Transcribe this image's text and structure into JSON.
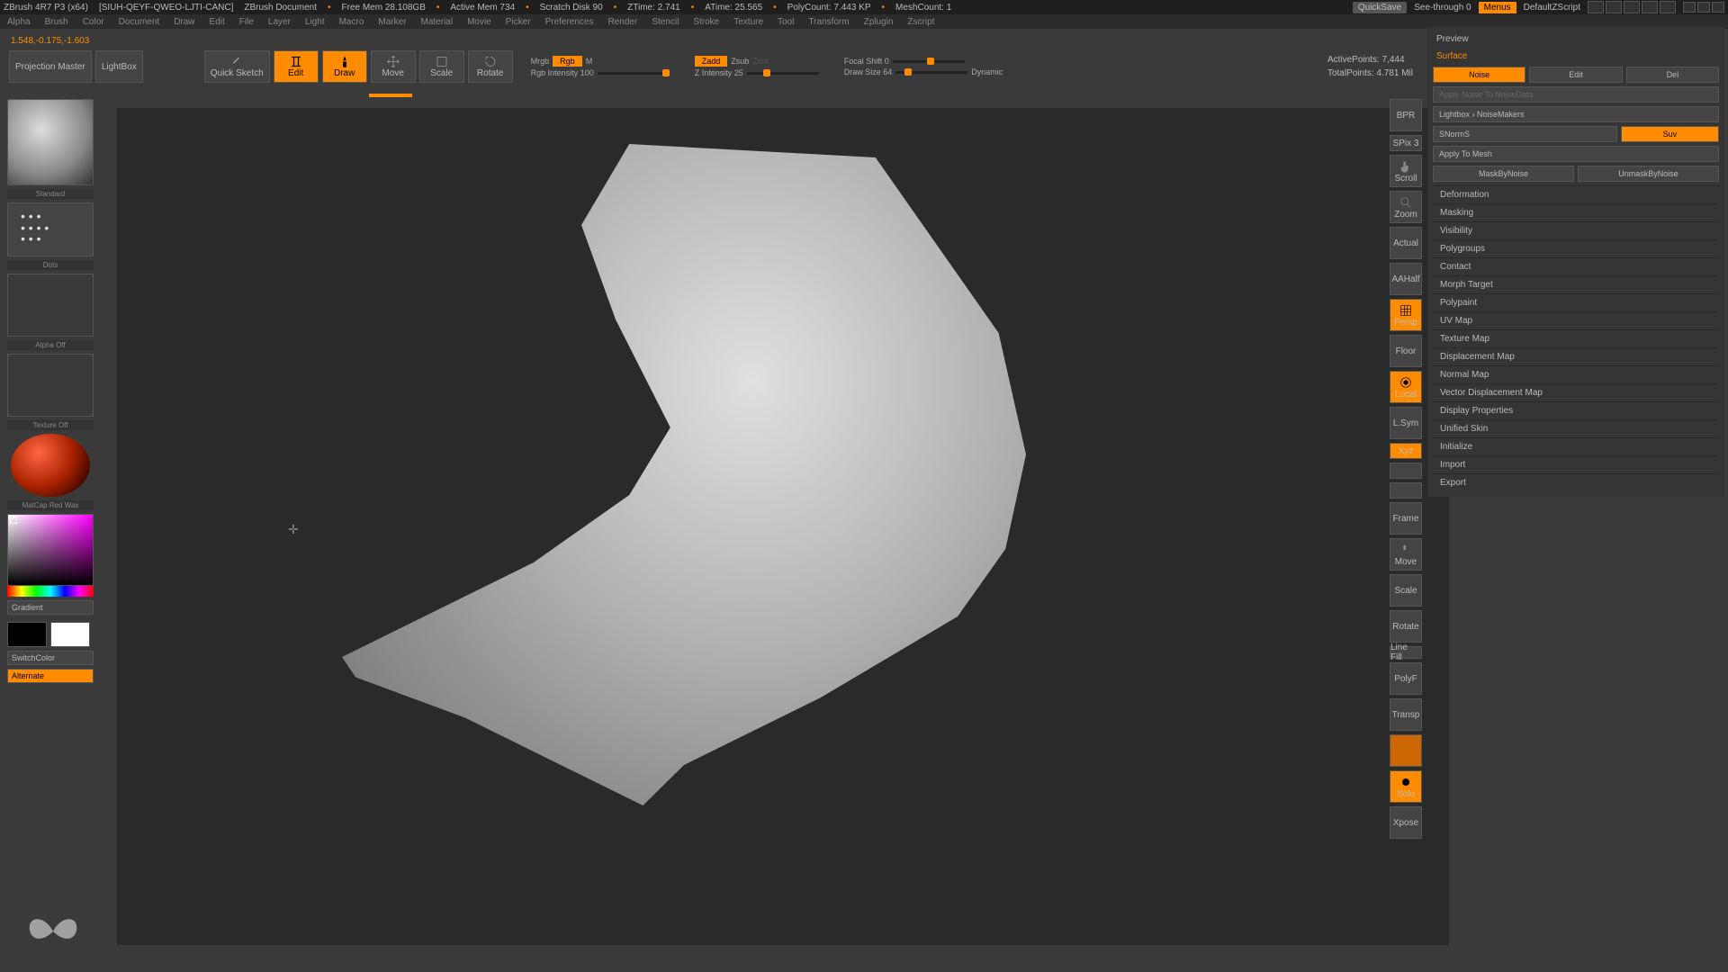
{
  "title": {
    "app": "ZBrush 4R7 P3 (x64)",
    "project": "[SIUH-QEYF-QWEO-LJTI-CANC]",
    "doc": "ZBrush Document",
    "free_mem": "Free Mem 28.108GB",
    "active_mem": "Active Mem 734",
    "scratch": "Scratch Disk 90",
    "ztime": "ZTime: 2.741",
    "atime": "ATime: 25.565",
    "polycount": "PolyCount: 7.443 KP",
    "meshcount": "MeshCount: 1",
    "quicksave": "QuickSave",
    "seethrough": "See-through  0",
    "menus": "Menus",
    "script": "DefaultZScript"
  },
  "menu": [
    "Alpha",
    "Brush",
    "Color",
    "Document",
    "Draw",
    "Edit",
    "File",
    "Layer",
    "Light",
    "Macro",
    "Marker",
    "Material",
    "Movie",
    "Picker",
    "Preferences",
    "Render",
    "Stencil",
    "Stroke",
    "Texture",
    "Tool",
    "Transform",
    "Zplugin",
    "Zscript"
  ],
  "coords": "1.548,-0.175,-1.603",
  "toolbar": {
    "projection": "Projection\nMaster",
    "lightbox": "LightBox",
    "quick_sketch": "Quick\nSketch",
    "edit": "Edit",
    "draw": "Draw",
    "move": "Move",
    "scale": "Scale",
    "rotate": "Rotate",
    "mrgb": "Mrgb",
    "rgb": "Rgb",
    "m": "M",
    "rgb_intensity": "Rgb Intensity 100",
    "zadd": "Zadd",
    "zsub": "Zsub",
    "zcut": "Zcut",
    "z_intensity": "Z Intensity 25",
    "focal": "Focal Shift 0",
    "draw_size": "Draw Size 64",
    "dynamic": "Dynamic",
    "active_points": "ActivePoints: 7,444",
    "total_points": "TotalPoints: 4.781 Mil"
  },
  "left": {
    "brush": "Standard",
    "dots": "Dots",
    "alpha": "Alpha Off",
    "texture": "Texture Off",
    "material": "MatCap Red Wax",
    "gradient": "Gradient",
    "switch": "SwitchColor",
    "alternate": "Alternate"
  },
  "dock": [
    "BPR",
    "SPix 3",
    "Scroll",
    "Zoom",
    "Actual",
    "AAHalf",
    "Persp",
    "Floor",
    "Local",
    "L.Sym",
    "Xyz",
    "",
    "",
    "Frame",
    "Move",
    "Scale",
    "Rotate",
    "Line Fill",
    "PolyF",
    "Transp",
    "",
    "Solo",
    "Xpose"
  ],
  "right": {
    "preview": "Preview",
    "surface": "Surface",
    "noise": "Noise",
    "edit": "Edit",
    "del": "Del",
    "apply_noise": "Apply Noise To NoiseData",
    "lightbox_nm": "Lightbox › NoiseMakers",
    "snorm": "SNormS",
    "suv": "Suv",
    "apply_mesh": "Apply To Mesh",
    "mask": "MaskByNoise",
    "unmask": "UnmaskByNoise",
    "sections": [
      "Deformation",
      "Masking",
      "Visibility",
      "Polygroups",
      "Contact",
      "Morph Target",
      "Polypaint",
      "UV Map",
      "Texture Map",
      "Displacement Map",
      "Normal Map",
      "Vector Displacement Map",
      "Display Properties",
      "Unified Skin",
      "Initialize",
      "Import",
      "Export"
    ]
  }
}
